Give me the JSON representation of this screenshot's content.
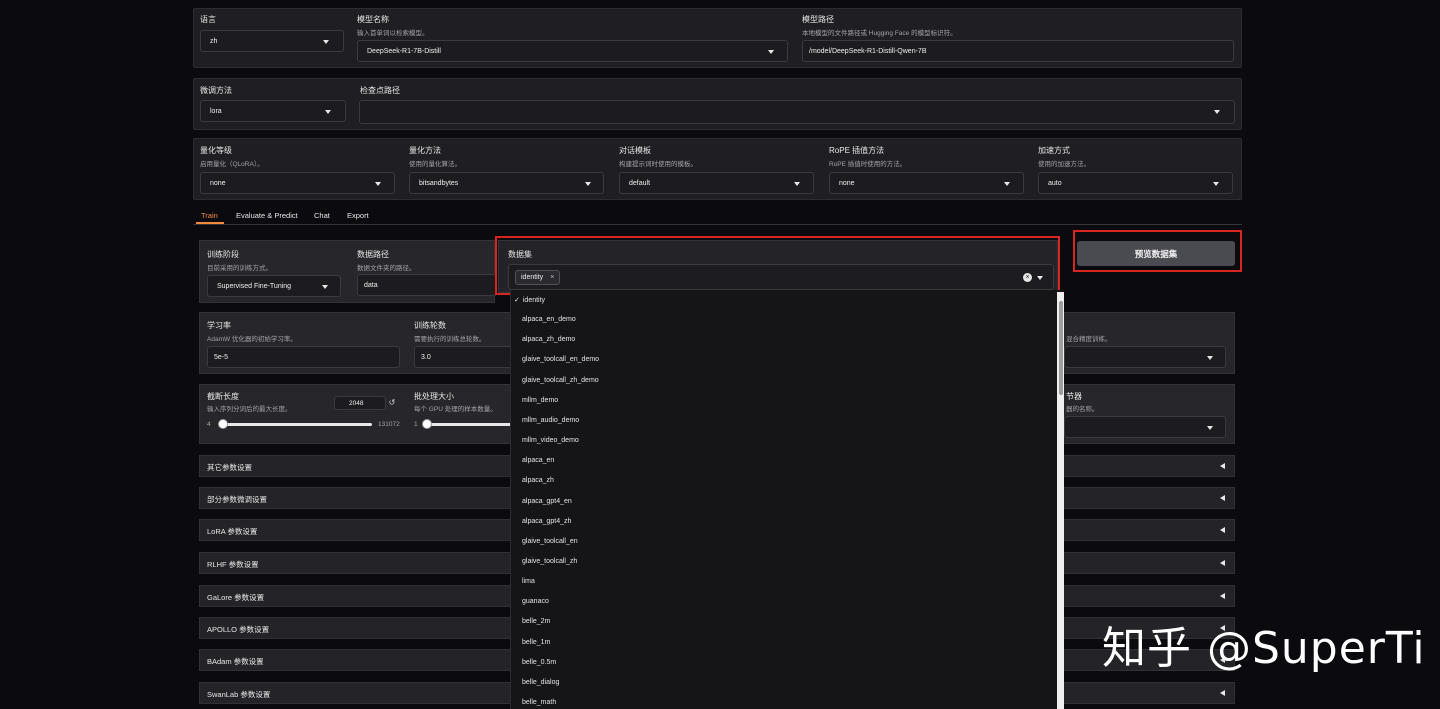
{
  "top": {
    "language": {
      "label": "语言",
      "value": "zh"
    },
    "model_name": {
      "label": "模型名称",
      "info": "输入首单词以检索模型。",
      "value": "DeepSeek-R1-7B-Distill"
    },
    "model_path": {
      "label": "模型路径",
      "info": "本地模型的文件路径或 Hugging Face 的模型标识符。",
      "value": "/model/DeepSeek-R1-Distill-Qwen-7B"
    }
  },
  "row2": {
    "finetune": {
      "label": "微调方法",
      "value": "lora"
    },
    "checkpoint": {
      "label": "检查点路径",
      "value": ""
    }
  },
  "row3": {
    "quant_bit": {
      "label": "量化等级",
      "info": "启用量化（QLoRA）。",
      "value": "none"
    },
    "quant_method": {
      "label": "量化方法",
      "info": "使用的量化算法。",
      "value": "bitsandbytes"
    },
    "template": {
      "label": "对话模板",
      "info": "构建提示词时使用的模板。",
      "value": "default"
    },
    "rope": {
      "label": "RoPE 插值方法",
      "info": "RoPE 插值时使用的方法。",
      "value": "none"
    },
    "booster": {
      "label": "加速方式",
      "info": "使用的加速方法。",
      "value": "auto"
    }
  },
  "tabs": [
    "Train",
    "Evaluate & Predict",
    "Chat",
    "Export"
  ],
  "train": {
    "stage": {
      "label": "训练阶段",
      "info": "目前采用的训练方式。",
      "value": "Supervised Fine-Tuning"
    },
    "dataset_dir": {
      "label": "数据路径",
      "info": "数据文件夹的路径。",
      "value": "data"
    },
    "dataset": {
      "label": "数据集",
      "chip": "identity",
      "chip_close": "×",
      "clear": "×"
    },
    "preview_button": "预览数据集",
    "lr": {
      "label": "学习率",
      "info": "AdamW 优化器的初始学习率。",
      "value": "5e-5"
    },
    "epochs": {
      "label": "训练轮数",
      "info": "需要执行的训练总轮数。",
      "value": "3.0"
    },
    "compute_info": "混合精度训练。",
    "cutoff": {
      "label": "截断长度",
      "info": "输入序列分词后的最大长度。",
      "number": "2048",
      "reset": "↺",
      "min": "4",
      "max": "131072",
      "fraction": 0.016
    },
    "batch": {
      "label": "批处理大小",
      "info": "每个 GPU 处理的样本数量。",
      "min": "1"
    },
    "scheduler_label_partial": "节器",
    "scheduler_info_partial": "器的名称。",
    "accordions": [
      "其它参数设置",
      "部分参数微调设置",
      "LoRA 参数设置",
      "RLHF 参数设置",
      "GaLore 参数设置",
      "APOLLO 参数设置",
      "BAdam 参数设置",
      "SwanLab 参数设置"
    ]
  },
  "dropdown": {
    "check": "✓",
    "items": [
      "identity",
      "alpaca_en_demo",
      "alpaca_zh_demo",
      "glaive_toolcall_en_demo",
      "glaive_toolcall_zh_demo",
      "mllm_demo",
      "mllm_audio_demo",
      "mllm_video_demo",
      "alpaca_en",
      "alpaca_zh",
      "alpaca_gpt4_en",
      "alpaca_gpt4_zh",
      "glaive_toolcall_en",
      "glaive_toolcall_zh",
      "lima",
      "guanaco",
      "belle_2m",
      "belle_1m",
      "belle_0.5m",
      "belle_dialog",
      "belle_math"
    ]
  },
  "watermark": "知乎 @SuperTi",
  "colors": {
    "accent": "#f58a3d",
    "highlight": "#d8261f",
    "bg": "#0b0b0f",
    "panel": "#1f1f23"
  }
}
